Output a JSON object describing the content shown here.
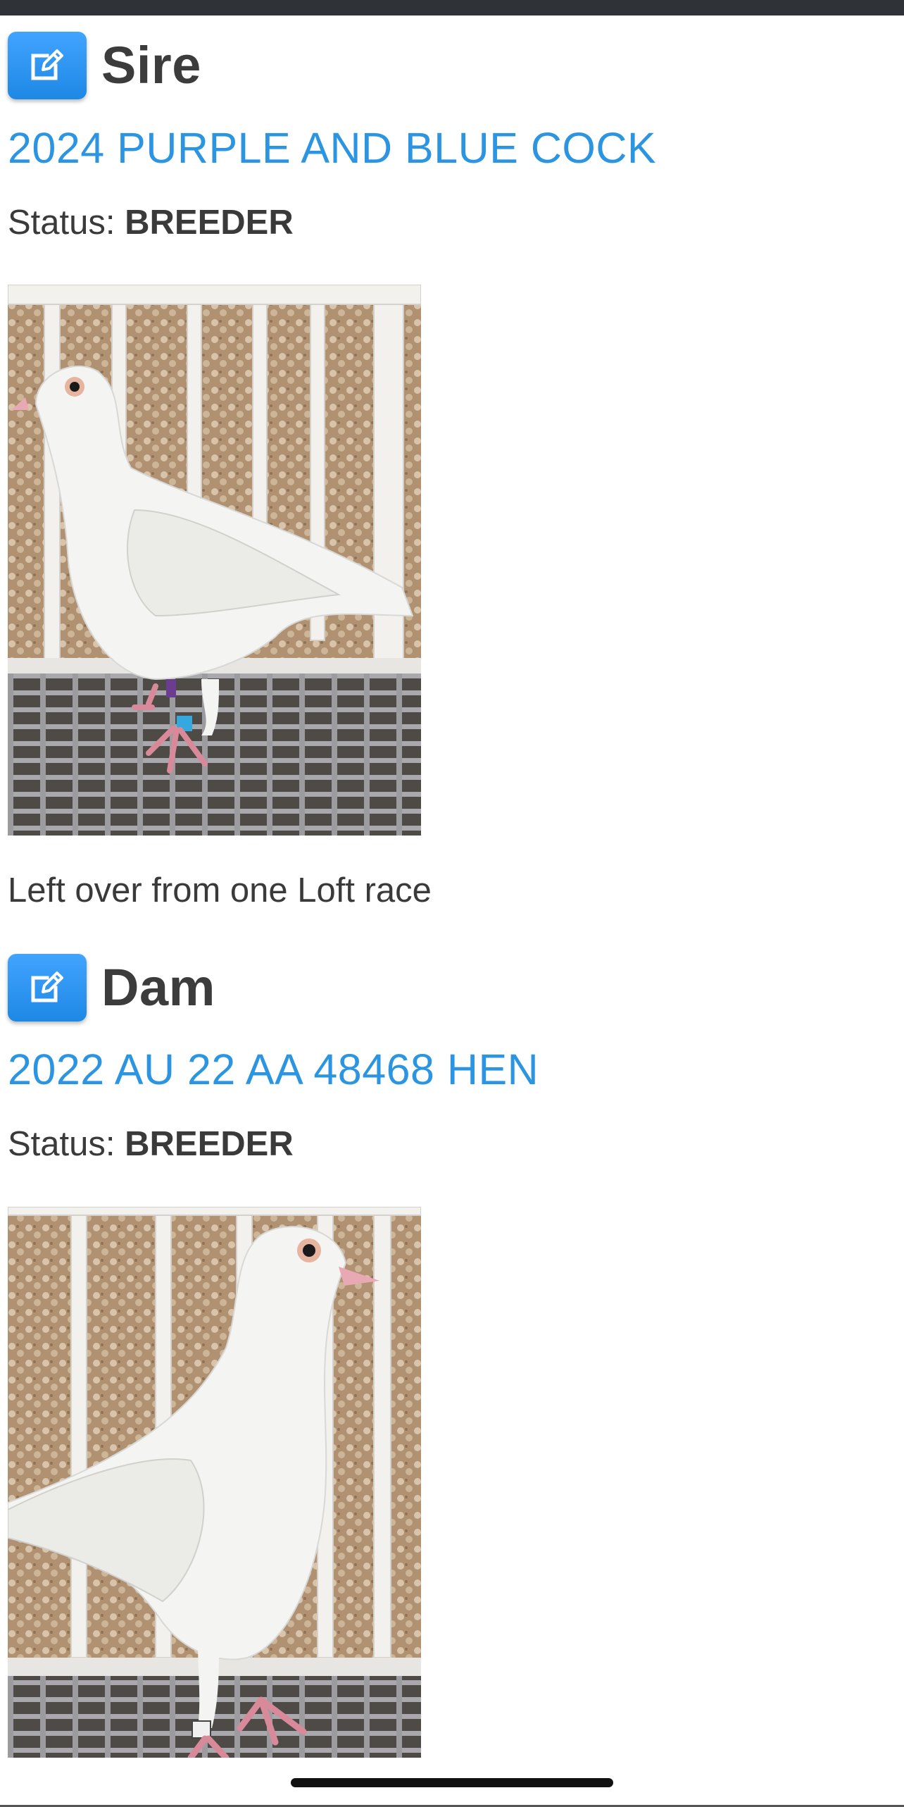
{
  "sire": {
    "heading": "Sire",
    "bird_name": "2024 PURPLE AND BLUE COCK",
    "status_label": "Status:",
    "status_value": "BREEDER",
    "note": "Left over from one Loft race"
  },
  "dam": {
    "heading": "Dam",
    "bird_name": "2022 AU 22 AA 48468 HEN",
    "status_label": "Status:",
    "status_value": "BREEDER"
  },
  "icons": {
    "edit": "edit-icon"
  },
  "colors": {
    "link": "#2b95e2",
    "button": "#2a92ee",
    "text": "#3a3a3a"
  }
}
